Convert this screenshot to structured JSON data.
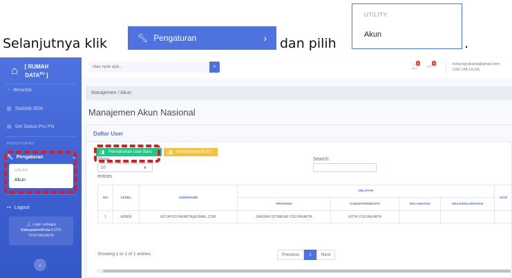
{
  "instruction": {
    "text_before": "Selanjutnya klik",
    "inline_button_label": "Pengaturan",
    "text_after": "dan pilih",
    "trailing_period": ".",
    "util_heading": "UTILITY:",
    "util_item": "Akun"
  },
  "sidebar": {
    "brand_line1": "[ RUMAH",
    "brand_line2": "DATA",
    "brand_sup": "KU",
    "brand_close": " ]",
    "items": [
      {
        "label": "Beranda",
        "icon": "gauge-icon"
      },
      {
        "label": "Statistik RDK",
        "icon": "chart-icon"
      },
      {
        "label": "Set Status Pro PN",
        "icon": "list-icon"
      }
    ],
    "heading": "PENGATURAN",
    "active_item": "Pengaturan",
    "submenu_heading": "UTILITY:",
    "submenu_item": "Akun",
    "logout": "Logout",
    "login_line1": "Login sebagai",
    "login_line2": "Kabupaten/Kota",
    "login_line2b": " KOTA",
    "login_line3": "YOGYAKARTA"
  },
  "topbar": {
    "search_placeholder": "Mau nyari apa...",
    "alerts_badge": "0",
    "messages_badge": "0",
    "user_email": "kotayogyakarta@gmail.com",
    "user_ip": "(192.168.14.24)"
  },
  "content": {
    "breadcrumb": "Manajemen / Akun",
    "page_title": "Manajemen Akun Nasional",
    "card_title": "Daftar User",
    "btn_permohonan_user": "Permohonan User Baru",
    "btn_permohonan_bast": "Permohonan BAST",
    "show_label": "Show",
    "show_value": "10",
    "entries_label": "entries",
    "search_label": "Search:",
    "table": {
      "group_header": "WILAYAH",
      "headers": [
        "NO",
        "LEVEL",
        "USERNAME",
        "PROVINSI",
        "KABUPATEN/KOTA",
        "KECAMATAN",
        "DESA/KELURAHAN",
        "AKSI"
      ],
      "rows": [
        [
          "1",
          "ADMIN",
          "KOTAYOGYAKARTA@GMAIL.COM",
          "DAERAH ISTIMEWA YOGYAKARTA",
          "KOTA YOGYAKARTA",
          "",
          "",
          ""
        ]
      ]
    },
    "info": "Showing 1 to 1 of 1 entries",
    "pager": {
      "prev": "Previous",
      "page": "1",
      "next": "Next"
    }
  },
  "colors": {
    "primary": "#4e73df",
    "success": "#1cc88a",
    "warning": "#f6c23e",
    "highlight": "#e01b1b"
  }
}
